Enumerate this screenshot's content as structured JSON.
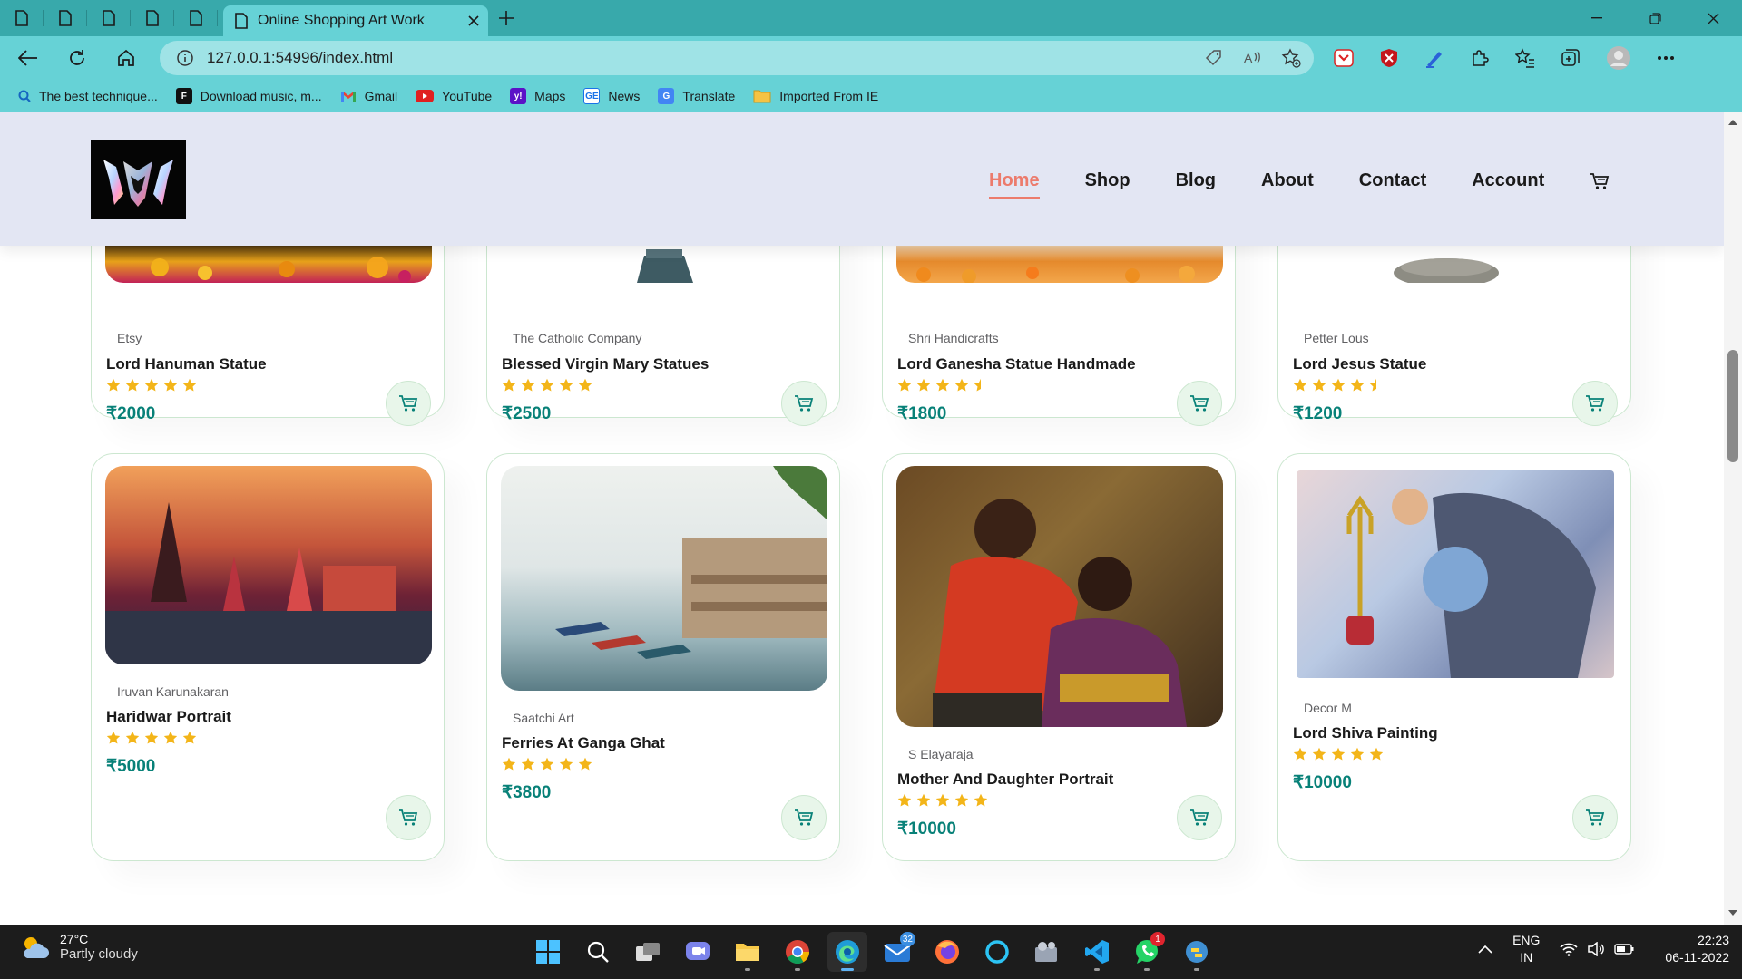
{
  "browser": {
    "active_tab_title": "Online Shopping Art Work",
    "url": "127.0.0.1:54996/index.html",
    "bookmarks": [
      {
        "label": "The best technique...",
        "icon": "search-icon"
      },
      {
        "label": "Download music, m...",
        "icon": "f-logo-icon"
      },
      {
        "label": "Gmail",
        "icon": "gmail-icon"
      },
      {
        "label": "YouTube",
        "icon": "youtube-icon"
      },
      {
        "label": "Maps",
        "icon": "yahoo-icon"
      },
      {
        "label": "News",
        "icon": "news-icon"
      },
      {
        "label": "Translate",
        "icon": "translate-icon"
      },
      {
        "label": "Imported From IE",
        "icon": "folder-icon"
      }
    ]
  },
  "site": {
    "nav": {
      "home": "Home",
      "shop": "Shop",
      "blog": "Blog",
      "about": "About",
      "contact": "Contact",
      "account": "Account"
    },
    "colors": {
      "accent": "#088178",
      "active_nav": "#ec7b6c",
      "star": "#f3b519",
      "header_bg": "#e3e6f3"
    },
    "products": [
      {
        "brand": "Etsy",
        "name": "Lord Hanuman Statue",
        "rating": 5,
        "price": "₹2000"
      },
      {
        "brand": "The Catholic Company",
        "name": "Blessed Virgin Mary Statues",
        "rating": 5,
        "price": "₹2500"
      },
      {
        "brand": "Shri Handicrafts",
        "name": "Lord Ganesha Statue Handmade",
        "rating": 4.5,
        "price": "₹1800"
      },
      {
        "brand": "Petter Lous",
        "name": "Lord Jesus Statue",
        "rating": 4.5,
        "price": "₹1200"
      },
      {
        "brand": "Iruvan Karunakaran",
        "name": "Haridwar Portrait",
        "rating": 5,
        "price": "₹5000"
      },
      {
        "brand": "Saatchi Art",
        "name": "Ferries At Ganga Ghat",
        "rating": 5,
        "price": "₹3800"
      },
      {
        "brand": "S Elayaraja",
        "name": "Mother And Daughter Portrait",
        "rating": 5,
        "price": "₹10000"
      },
      {
        "brand": "Decor M",
        "name": "Lord Shiva Painting",
        "rating": 5,
        "price": "₹10000"
      }
    ]
  },
  "taskbar": {
    "temperature": "27°C",
    "weather": "Partly cloudy",
    "mail_badge": "32",
    "whatsapp_badge": "1",
    "lang_1": "ENG",
    "lang_2": "IN",
    "time": "22:23",
    "date": "06-11-2022"
  }
}
